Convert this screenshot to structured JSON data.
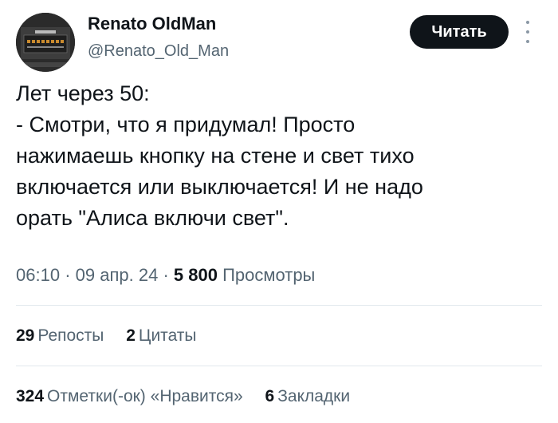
{
  "author": {
    "display_name": "Renato OldMan",
    "handle": "@Renato_Old_Man",
    "avatar_icon": "onkyo-device-avatar",
    "avatar_text": "ONKYO"
  },
  "follow_button_label": "Читать",
  "more_icon": "more-vertical-icon",
  "tweet_lines": [
    "Лет через 50:",
    "- Смотри, что я придумал! Просто",
    "нажимаешь кнопку на стене и свет тихо",
    "включается или выключается! И не надо",
    "орать \"Алиса включи свет\"."
  ],
  "meta": {
    "time": "06:10",
    "separator": "·",
    "date": "09 апр. 24",
    "views_count": "5 800",
    "views_label": "Просмотры"
  },
  "stats_row_1": [
    {
      "count": "29",
      "label": "Репосты"
    },
    {
      "count": "2",
      "label": "Цитаты"
    }
  ],
  "stats_row_2": [
    {
      "count": "324",
      "label": "Отметки(-ок) «Нравится»"
    },
    {
      "count": "6",
      "label": "Закладки"
    }
  ],
  "colors": {
    "text_primary": "#0f1419",
    "text_secondary": "#536471",
    "button_bg": "#0f1419",
    "divider": "#e1e8ed"
  }
}
